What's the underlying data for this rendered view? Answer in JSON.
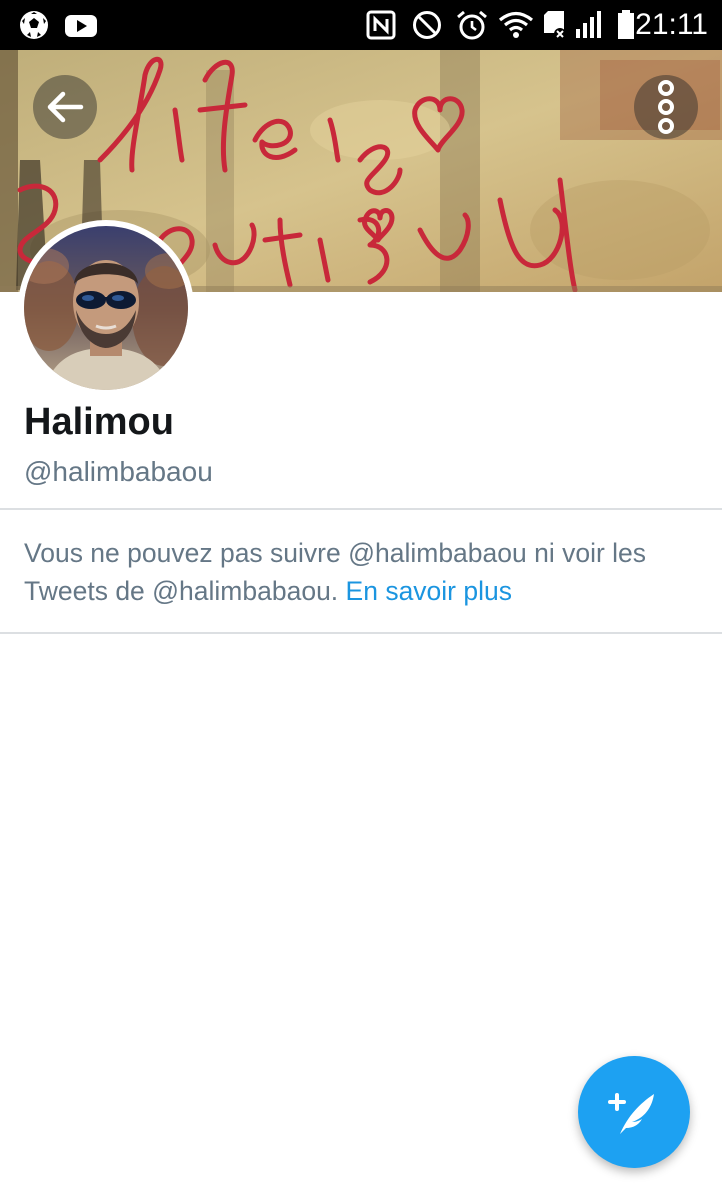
{
  "status_bar": {
    "time": "21:11",
    "icons": [
      "soccer-ball-icon",
      "youtube-icon",
      "nfc-icon",
      "do-not-disturb-icon",
      "alarm-icon",
      "wifi-icon",
      "sd-card-icon",
      "signal-icon",
      "battery-icon"
    ]
  },
  "banner": {
    "description_icons": [
      "back-arrow-icon",
      "more-vertical-icon"
    ]
  },
  "profile": {
    "display_name": "Halimou",
    "handle": "@halimbabaou"
  },
  "notice": {
    "text": "Vous ne pouvez pas suivre @halimbabaou ni voir les Tweets de @halimbabaou.",
    "link_label": "En savoir plus"
  },
  "fab": {
    "icon": "compose-tweet-icon"
  },
  "colors": {
    "accent": "#1da1f2",
    "link": "#1b95e0",
    "primary_text": "#14171a",
    "secondary_text": "#657786",
    "divider": "#dcdfe2"
  }
}
